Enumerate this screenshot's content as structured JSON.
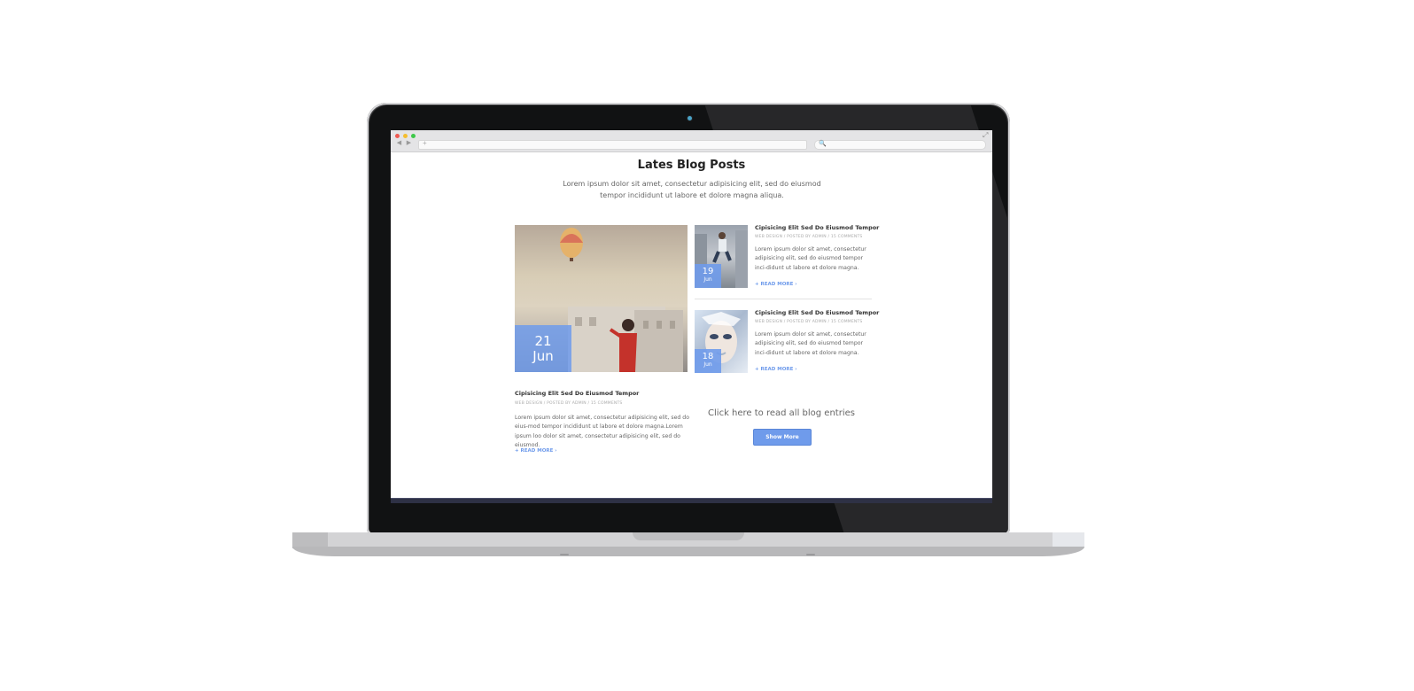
{
  "page": {
    "title": "Lates Blog Posts",
    "subtitle": "Lorem ipsum dolor sit amet, consectetur adipisicing elit, sed do eiusmod tempor incididunt ut labore et dolore magna aliqua."
  },
  "browser": {
    "back": "◀",
    "forward": "▶",
    "url_icon": "+",
    "search_icon": "🔍",
    "expand_icon": "⤢"
  },
  "featured_post": {
    "day": "21",
    "month": "Jun",
    "title": "Cipisicing Elit Sed Do Eiusmod Tempor",
    "meta": "WEB DESIGN  /  POSTED BY ADMIN  /  15 COMMENTS",
    "excerpt": "Lorem ipsum dolor sit amet, consectetur adipisicing elit, sed do eius-mod tempor incididunt ut labore et dolore magna.Lorem ipsum loo dolor sit amet, consectetur adipisicing elit, sed do eiusmod.",
    "read_more": "+ READ MORE ›"
  },
  "side_posts": [
    {
      "day": "19",
      "month": "Jun",
      "title": "Cipisicing Elit Sed Do Eiusmod Tempor",
      "meta": "WEB DESIGN  /  POSTED BY ADMIN  /  15 COMMENTS",
      "excerpt": "Lorem ipsum dolor sit amet, consectetur adipisicing elit, sed do eiusmod tempor inci-didunt ut labore et dolore magna.",
      "read_more": "+ READ MORE ›"
    },
    {
      "day": "18",
      "month": "Jun",
      "title": "Cipisicing Elit Sed Do Eiusmod Tempor",
      "meta": "WEB DESIGN  /  POSTED BY ADMIN  /  15 COMMENTS",
      "excerpt": "Lorem ipsum dolor sit amet, consectetur adipisicing elit, sed do eiusmod tempor inci-didunt ut labore et dolore magna.",
      "read_more": "+ READ MORE ›"
    }
  ],
  "cta": {
    "text": "Click here to read all blog entries",
    "button": "Show More"
  },
  "colors": {
    "accent": "#6f9beb",
    "title": "#222222",
    "text": "#666666"
  }
}
